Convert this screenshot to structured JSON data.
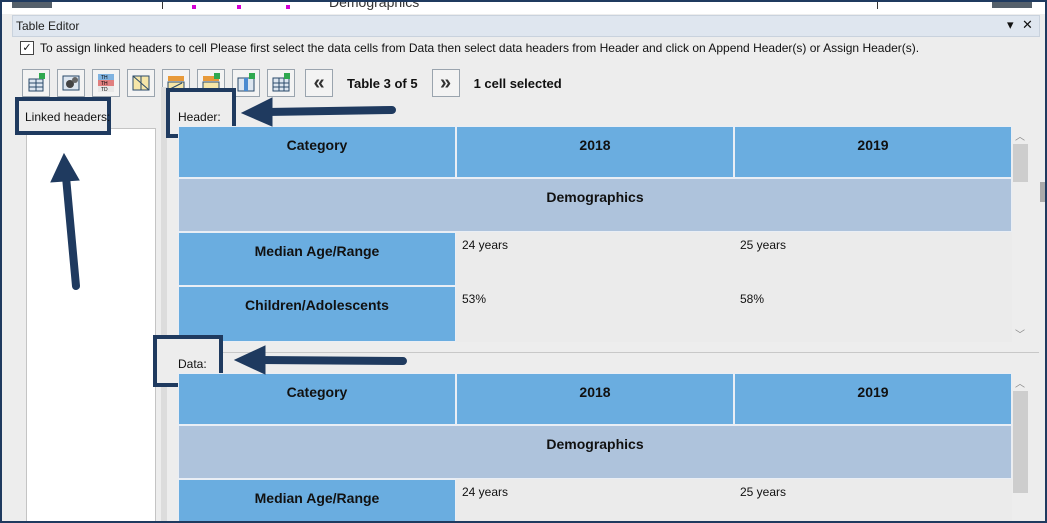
{
  "window": {
    "top_fragment": "Demographics",
    "title": "Table Editor",
    "pin_icon": "pin-dropdown-icon",
    "close_icon": "close-icon",
    "pin_glyph": "▾",
    "close_glyph": "✕"
  },
  "instruction": {
    "checked": true,
    "check_glyph": "✓",
    "text": "To assign linked headers to cell Please first select the data cells from Data then select data headers from Header and click on Append Header(s) or Assign Header(s)."
  },
  "toolbar": {
    "buttons": [
      {
        "icon": "insert-table-icon"
      },
      {
        "icon": "table-settings-icon"
      },
      {
        "icon": "th-td-icon"
      },
      {
        "icon": "diagonal-header-icon"
      },
      {
        "icon": "append-header-icon"
      },
      {
        "icon": "assign-header-icon"
      },
      {
        "icon": "add-column-icon"
      },
      {
        "icon": "add-row-icon"
      }
    ],
    "prev_glyph": "«",
    "next_glyph": "»",
    "table_position": "Table 3 of 5",
    "selection_status": "1 cell selected"
  },
  "left_panel": {
    "label": "Linked headers:"
  },
  "header_section": {
    "label": "Header:",
    "columns": [
      "Category",
      "2018",
      "2019"
    ],
    "group": "Demographics",
    "rows": [
      {
        "label": "Median Age/Range",
        "values": [
          "24 years",
          "25 years"
        ]
      },
      {
        "label": "Children/Adolescents",
        "values": [
          "53%",
          "58%"
        ]
      }
    ]
  },
  "data_section": {
    "label": "Data:",
    "columns": [
      "Category",
      "2018",
      "2019"
    ],
    "group": "Demographics",
    "rows": [
      {
        "label": "Median Age/Range",
        "values": [
          "24 years",
          "25 years"
        ]
      }
    ]
  },
  "colors": {
    "header_blue": "#6aade0",
    "group_blue": "#aec3dc",
    "annotation_navy": "#1f3a5f"
  }
}
